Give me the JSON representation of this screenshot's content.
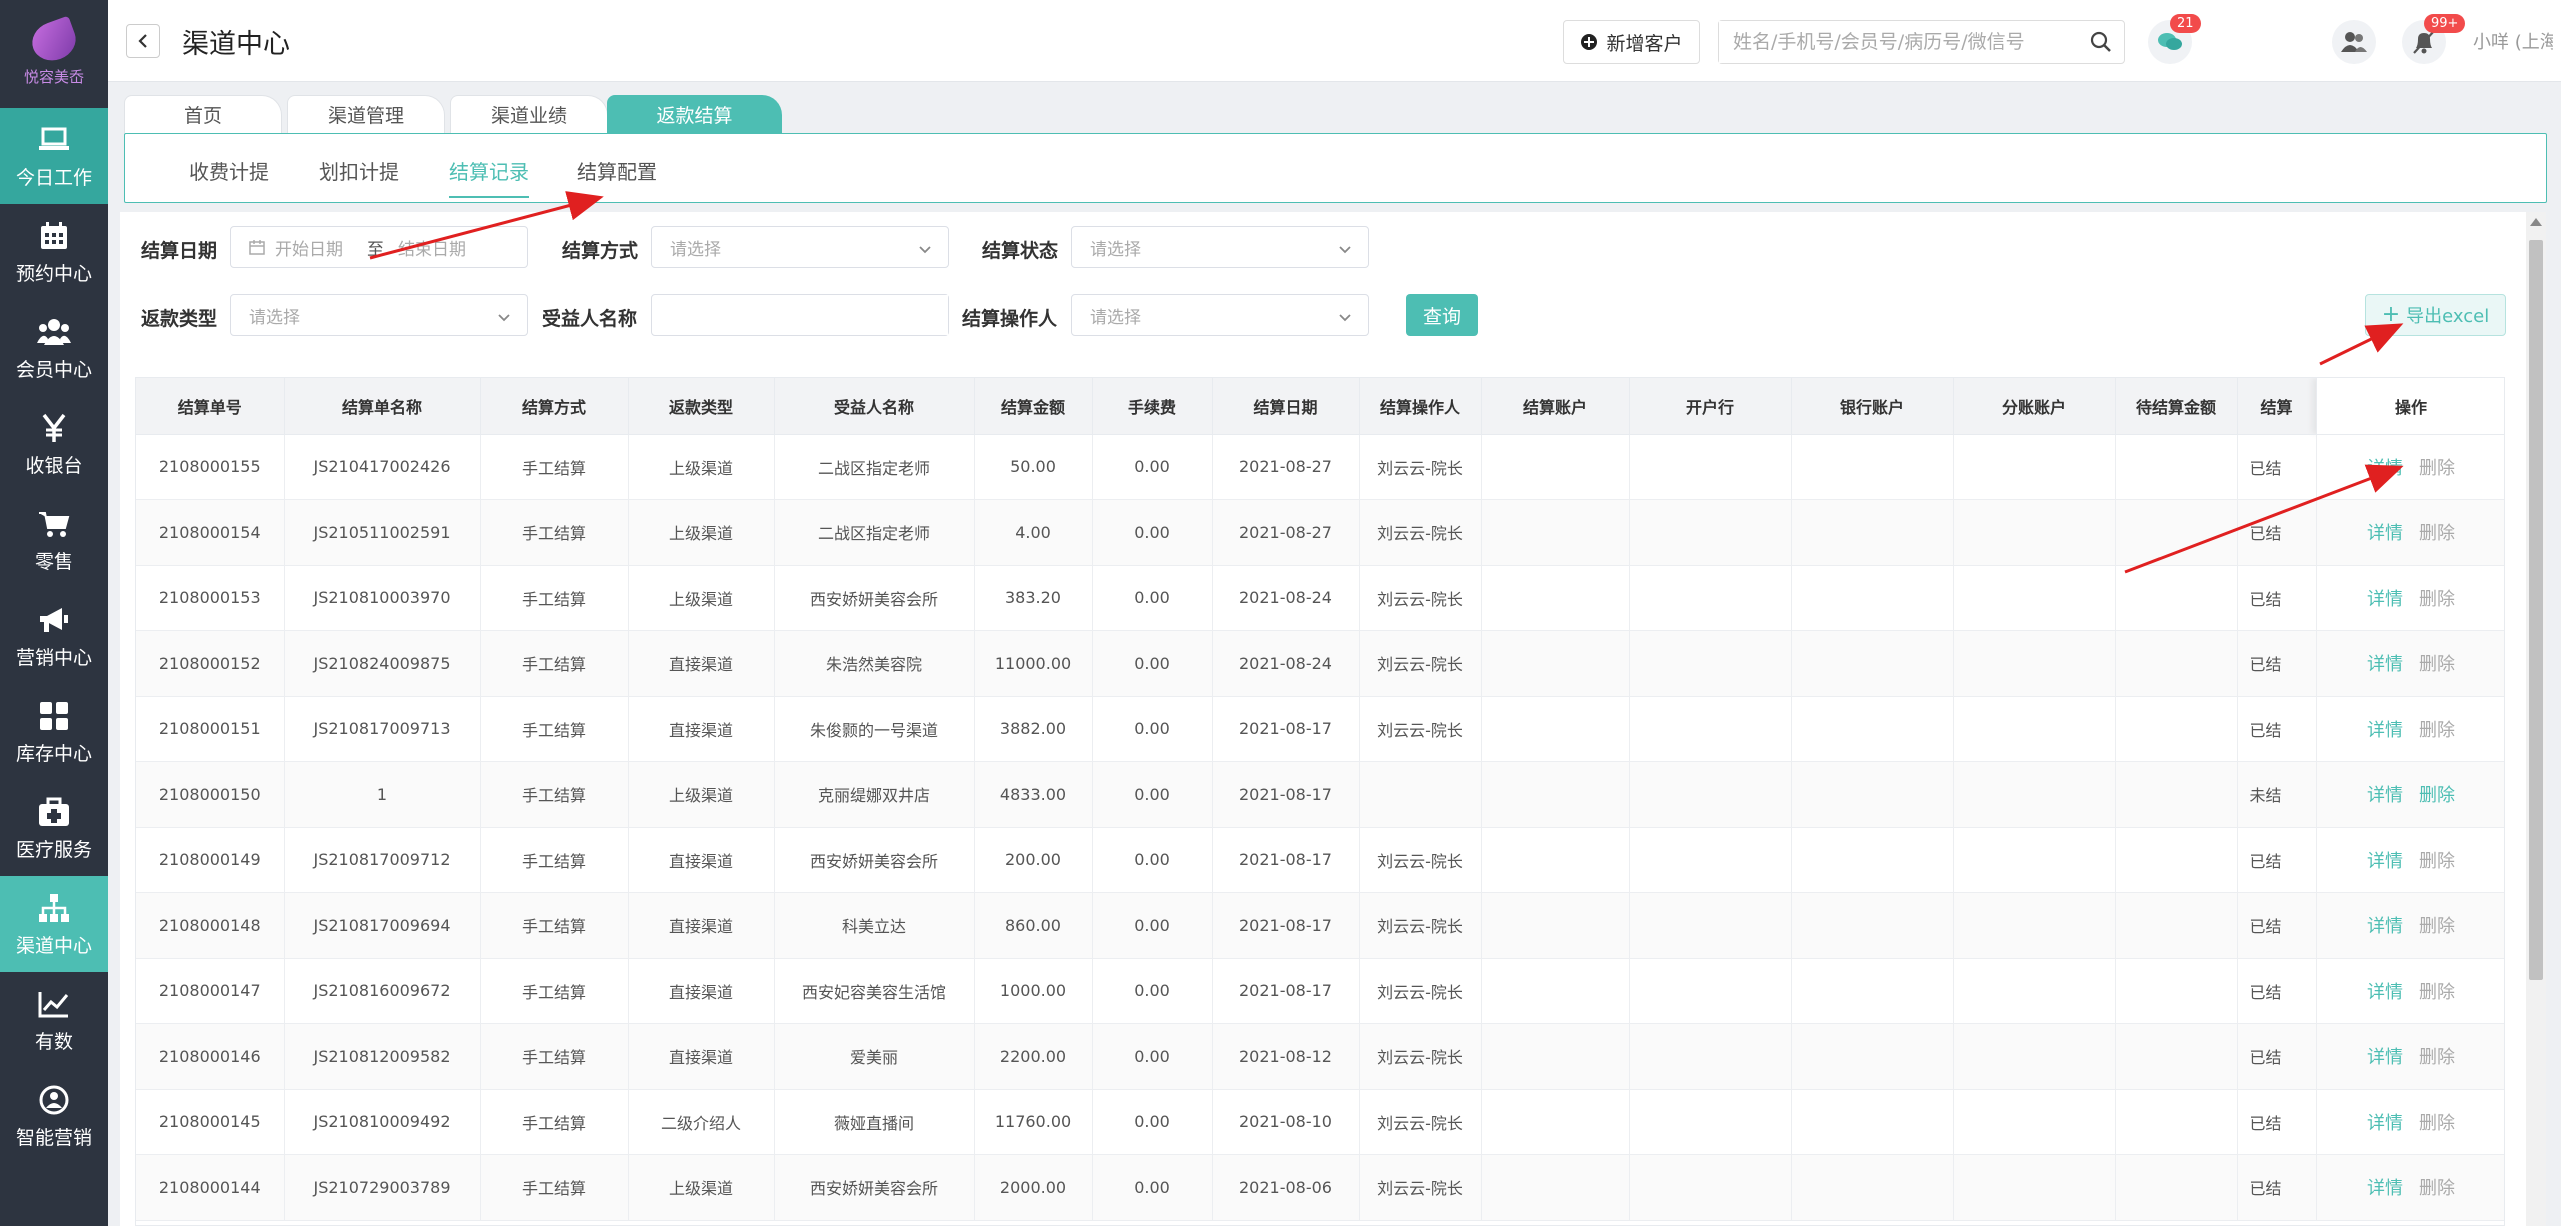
{
  "app": {
    "logo_text": "悦容美岙",
    "title": "渠道中心"
  },
  "sidebar": {
    "items": [
      {
        "label": "今日工作",
        "icon": "laptop-icon"
      },
      {
        "label": "预约中心",
        "icon": "calendar-icon"
      },
      {
        "label": "会员中心",
        "icon": "members-icon"
      },
      {
        "label": "收银台",
        "icon": "yen-icon"
      },
      {
        "label": "零售",
        "icon": "cart-icon"
      },
      {
        "label": "营销中心",
        "icon": "megaphone-icon"
      },
      {
        "label": "库存中心",
        "icon": "grid-icon"
      },
      {
        "label": "医疗服务",
        "icon": "medkit-icon"
      },
      {
        "label": "渠道中心",
        "icon": "sitemap-icon"
      },
      {
        "label": "有数",
        "icon": "trend-icon"
      },
      {
        "label": "智能营销",
        "icon": "robot-icon"
      }
    ]
  },
  "header": {
    "new_customer": "新增客户",
    "search_placeholder": "姓名/手机号/会员号/病历号/微信号",
    "badge_chat": "21",
    "badge_notify": "99+",
    "user": "小咩 (上海张江门诊)"
  },
  "tabs": [
    "首页",
    "渠道管理",
    "渠道业绩",
    "返款结算"
  ],
  "subtabs": [
    "收费计提",
    "划扣计提",
    "结算记录",
    "结算配置"
  ],
  "filters": {
    "settle_date": "结算日期",
    "start_placeholder": "开始日期",
    "to": "至",
    "end_placeholder": "结束日期",
    "settle_method": "结算方式",
    "settle_status": "结算状态",
    "refund_type": "返款类型",
    "beneficiary": "受益人名称",
    "operator": "结算操作人",
    "select_placeholder": "请选择",
    "query": "查询",
    "export": "导出excel"
  },
  "table": {
    "headers": [
      "结算单号",
      "结算单名称",
      "结算方式",
      "返款类型",
      "受益人名称",
      "结算金额",
      "手续费",
      "结算日期",
      "结算操作人",
      "结算账户",
      "开户行",
      "银行账户",
      "分账账户",
      "待结算金额",
      "结算",
      "操作"
    ],
    "detail": "详情",
    "delete": "删除",
    "rows": [
      [
        "2108000155",
        "JS210417002426",
        "手工结算",
        "上级渠道",
        "二战区指定老师",
        "50.00",
        "0.00",
        "2021-08-27",
        "刘云云-院长",
        "",
        "",
        "",
        "",
        "",
        "已结"
      ],
      [
        "2108000154",
        "JS210511002591",
        "手工结算",
        "上级渠道",
        "二战区指定老师",
        "4.00",
        "0.00",
        "2021-08-27",
        "刘云云-院长",
        "",
        "",
        "",
        "",
        "",
        "已结"
      ],
      [
        "2108000153",
        "JS210810003970",
        "手工结算",
        "上级渠道",
        "西安娇妍美容会所",
        "383.20",
        "0.00",
        "2021-08-24",
        "刘云云-院长",
        "",
        "",
        "",
        "",
        "",
        "已结"
      ],
      [
        "2108000152",
        "JS210824009875",
        "手工结算",
        "直接渠道",
        "朱浩然美容院",
        "11000.00",
        "0.00",
        "2021-08-24",
        "刘云云-院长",
        "",
        "",
        "",
        "",
        "",
        "已结"
      ],
      [
        "2108000151",
        "JS210817009713",
        "手工结算",
        "直接渠道",
        "朱俊颢的一号渠道",
        "3882.00",
        "0.00",
        "2021-08-17",
        "刘云云-院长",
        "",
        "",
        "",
        "",
        "",
        "已结"
      ],
      [
        "2108000150",
        "1",
        "手工结算",
        "上级渠道",
        "克丽缇娜双井店",
        "4833.00",
        "0.00",
        "2021-08-17",
        "",
        "",
        "",
        "",
        "",
        "",
        "未结"
      ],
      [
        "2108000149",
        "JS210817009712",
        "手工结算",
        "直接渠道",
        "西安娇妍美容会所",
        "200.00",
        "0.00",
        "2021-08-17",
        "刘云云-院长",
        "",
        "",
        "",
        "",
        "",
        "已结"
      ],
      [
        "2108000148",
        "JS210817009694",
        "手工结算",
        "直接渠道",
        "科美立达",
        "860.00",
        "0.00",
        "2021-08-17",
        "刘云云-院长",
        "",
        "",
        "",
        "",
        "",
        "已结"
      ],
      [
        "2108000147",
        "JS210816009672",
        "手工结算",
        "直接渠道",
        "西安妃容美容生活馆",
        "1000.00",
        "0.00",
        "2021-08-17",
        "刘云云-院长",
        "",
        "",
        "",
        "",
        "",
        "已结"
      ],
      [
        "2108000146",
        "JS210812009582",
        "手工结算",
        "直接渠道",
        "爱美丽",
        "2200.00",
        "0.00",
        "2021-08-12",
        "刘云云-院长",
        "",
        "",
        "",
        "",
        "",
        "已结"
      ],
      [
        "2108000145",
        "JS210810009492",
        "手工结算",
        "二级介绍人",
        "薇娅直播间",
        "11760.00",
        "0.00",
        "2021-08-10",
        "刘云云-院长",
        "",
        "",
        "",
        "",
        "",
        "已结"
      ],
      [
        "2108000144",
        "JS210729003789",
        "手工结算",
        "上级渠道",
        "西安娇妍美容会所",
        "2000.00",
        "0.00",
        "2021-08-06",
        "刘云云-院长",
        "",
        "",
        "",
        "",
        "",
        "已结"
      ]
    ]
  }
}
